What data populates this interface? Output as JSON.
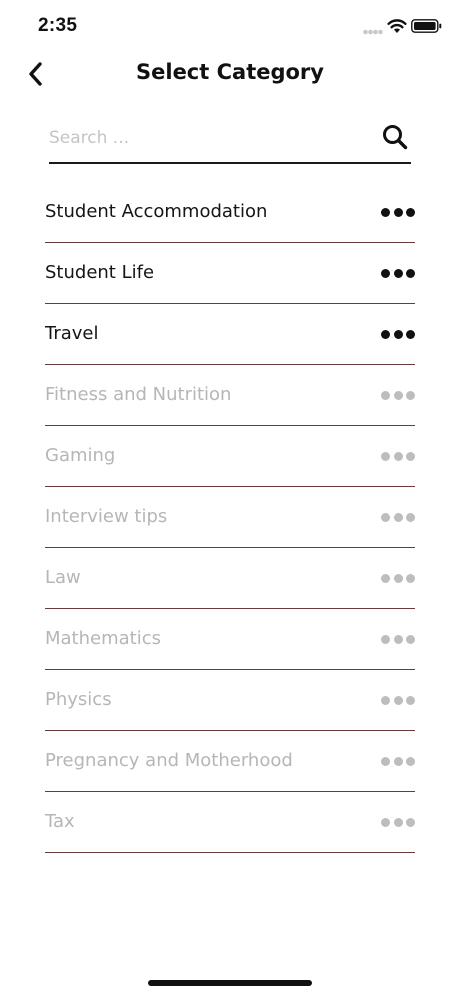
{
  "status_bar": {
    "time": "2:35"
  },
  "header": {
    "title": "Select Category",
    "back_icon": "chevron-left-icon"
  },
  "search": {
    "placeholder": "Search ...",
    "value": "",
    "icon": "search-icon"
  },
  "categories": [
    {
      "label": "Student Accommodation",
      "state": "active"
    },
    {
      "label": "Student Life",
      "state": "active"
    },
    {
      "label": "Travel",
      "state": "active"
    },
    {
      "label": "Fitness and Nutrition",
      "state": "inactive"
    },
    {
      "label": "Gaming",
      "state": "inactive"
    },
    {
      "label": "Interview tips",
      "state": "inactive"
    },
    {
      "label": "Law",
      "state": "inactive"
    },
    {
      "label": "Mathematics",
      "state": "inactive"
    },
    {
      "label": "Physics",
      "state": "inactive"
    },
    {
      "label": "Pregnancy and Motherhood",
      "state": "inactive"
    },
    {
      "label": "Tax",
      "state": "inactive"
    }
  ],
  "colors": {
    "active_text": "#151515",
    "inactive_text": "#b6b6b6",
    "divider": "#6b3a3a",
    "background": "#ffffff"
  }
}
